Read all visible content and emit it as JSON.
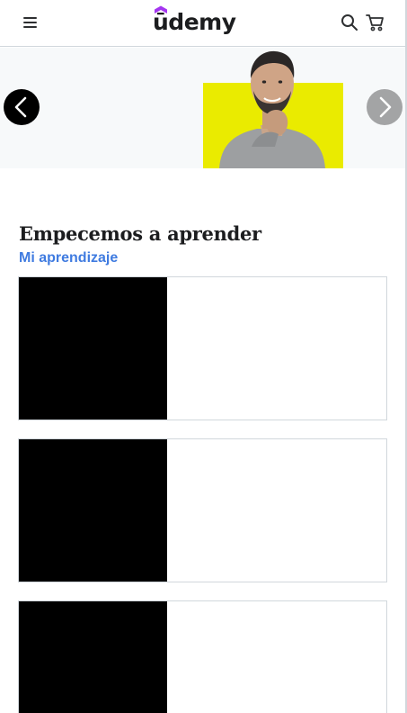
{
  "header": {
    "logo_text": "ūdemy",
    "menu_icon": "hamburger-menu-icon",
    "search_icon": "search-icon",
    "cart_icon": "shopping-cart-icon"
  },
  "banner": {
    "prev_icon": "chevron-left-icon",
    "next_icon": "chevron-right-icon",
    "accent_color": "#eaeb00"
  },
  "learning": {
    "title": "Empecemos a aprender",
    "link_label": "Mi aprendizaje",
    "courses": [
      {
        "index": 1
      },
      {
        "index": 2
      },
      {
        "index": 3
      }
    ]
  },
  "colors": {
    "link": "#3f7be0",
    "brand": "#a435f0",
    "text": "#1c1d1f"
  }
}
